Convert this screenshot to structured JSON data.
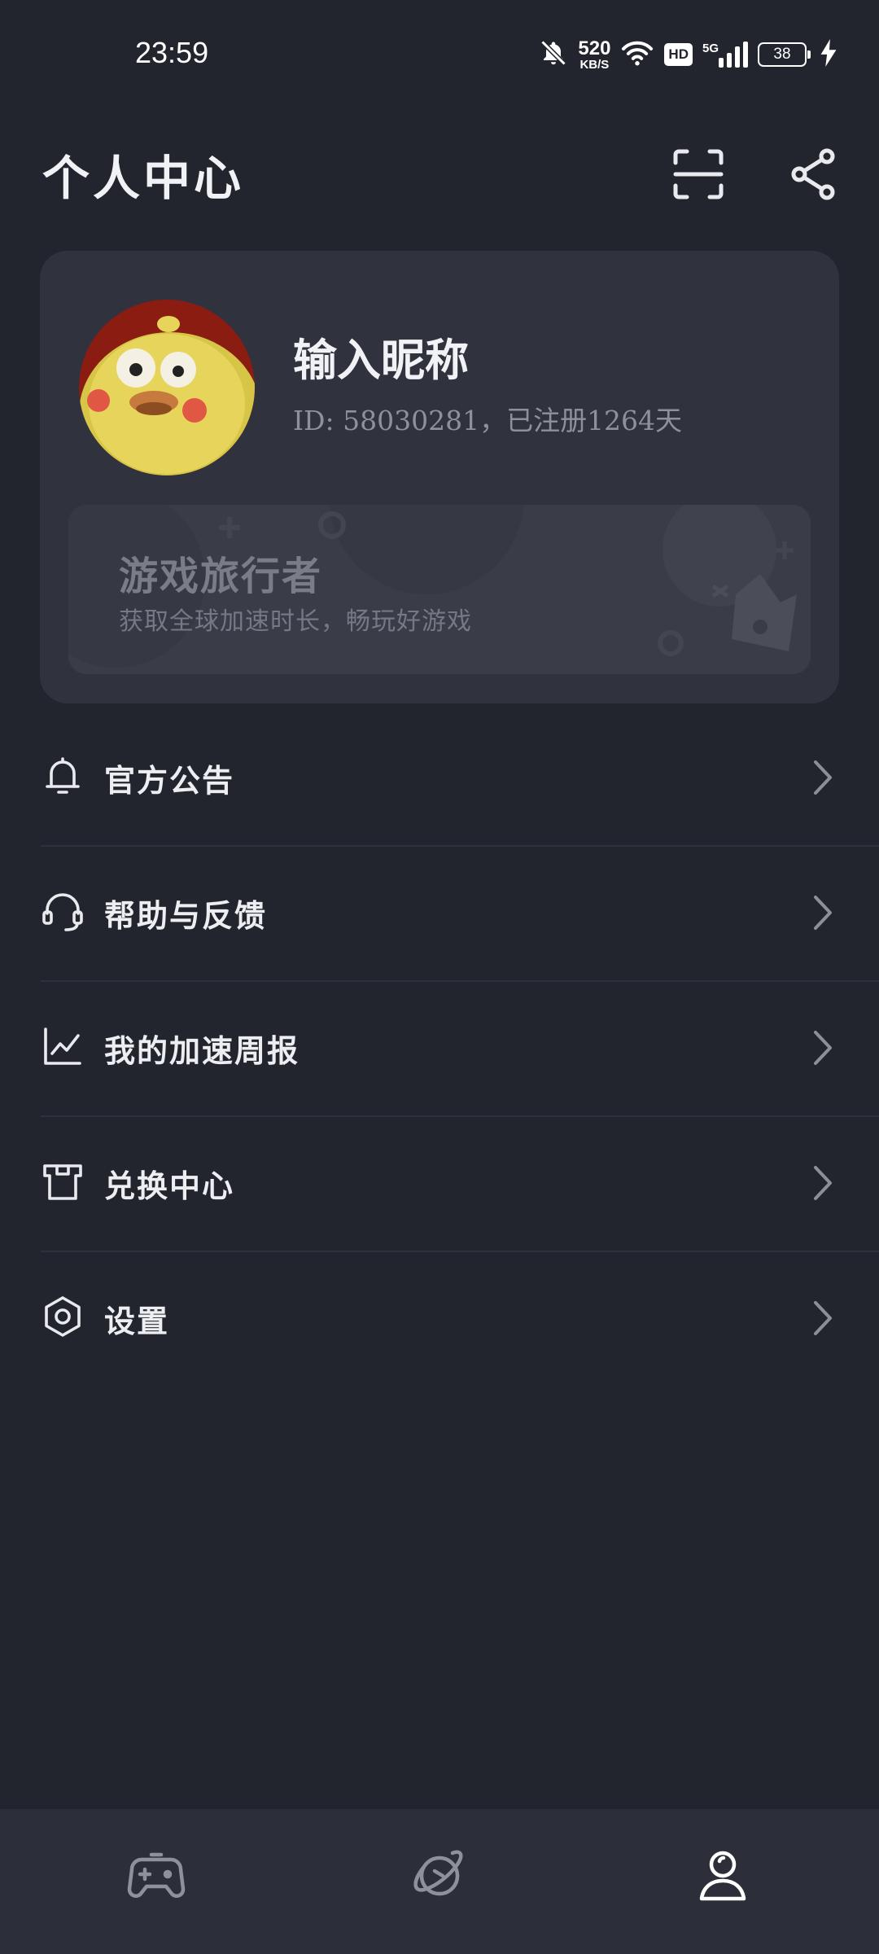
{
  "status_bar": {
    "time": "23:59",
    "speed_value": "520",
    "speed_unit": "KB/S",
    "hd_label": "HD",
    "network": "5G",
    "battery": "38",
    "icons": [
      "mute-bell-icon",
      "wifi-icon",
      "signal-icon",
      "battery-icon",
      "charging-icon"
    ]
  },
  "header": {
    "title": "个人中心",
    "scan_icon": "scan-icon",
    "share_icon": "share-icon"
  },
  "profile": {
    "nickname": "输入昵称",
    "id_text": "ID: 58030281，已注册1264天",
    "avatar": "cartoon-chick-avatar"
  },
  "promo": {
    "title": "游戏旅行者",
    "subtitle": "获取全球加速时长，畅玩好游戏"
  },
  "menu": [
    {
      "label": "官方公告",
      "icon": "bell-icon"
    },
    {
      "label": "帮助与反馈",
      "icon": "headset-icon"
    },
    {
      "label": "我的加速周报",
      "icon": "line-chart-icon"
    },
    {
      "label": "兑换中心",
      "icon": "shirt-icon"
    },
    {
      "label": "设置",
      "icon": "hexagon-settings-icon"
    }
  ],
  "bottom_nav": [
    {
      "icon": "gamepad-icon",
      "active": false
    },
    {
      "icon": "planet-icon",
      "active": false
    },
    {
      "icon": "person-icon",
      "active": true
    }
  ],
  "colors": {
    "background": "#23252e",
    "card": "#30333e",
    "promo_card": "#3a3d48",
    "text_primary": "#eceef2",
    "text_secondary": "#8e919c",
    "nav_bg": "#2c2f39"
  }
}
